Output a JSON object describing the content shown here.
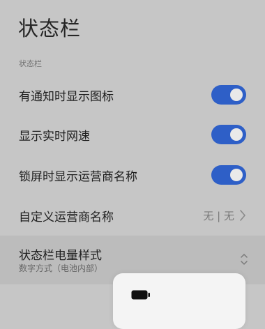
{
  "page": {
    "title": "状态栏",
    "section_label": "状态栏"
  },
  "settings": [
    {
      "label": "有通知时显示图标",
      "toggle_on": true
    },
    {
      "label": "显示实时网速",
      "toggle_on": true
    },
    {
      "label": "锁屏时显示运营商名称",
      "toggle_on": true
    }
  ],
  "carrier_name": {
    "label": "自定义运营商名称",
    "value": "无 | 无"
  },
  "battery_style": {
    "label": "状态栏电量样式",
    "current_value": "数字方式（电池内部）"
  },
  "icons": {
    "chevron": "chevron-right-icon",
    "updown": "updown-arrow-icon",
    "battery": "battery-icon"
  },
  "colors": {
    "toggle_on": "#2e5fc7",
    "background": "#c6c6c6"
  }
}
